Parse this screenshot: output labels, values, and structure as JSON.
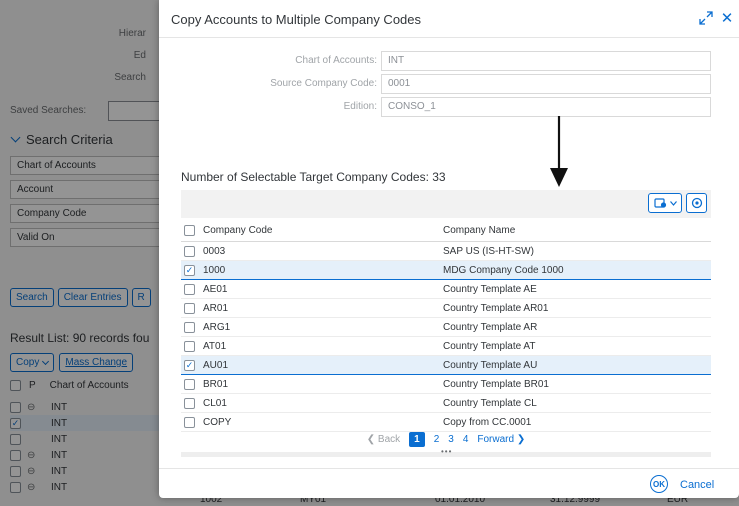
{
  "background": {
    "labels": {
      "hierarchy": "Hierar",
      "edition": "Ed",
      "search": "Search"
    },
    "saved_searches_label": "Saved Searches:",
    "search_criteria_title": "Search Criteria",
    "criteria_fields": [
      "Chart of Accounts",
      "Account",
      "Company Code",
      "Valid On"
    ],
    "buttons": {
      "search": "Search",
      "clear": "Clear Entries",
      "more": "R"
    },
    "result_title": "Result List: 90 records fou",
    "toolbar": {
      "copy": "Copy",
      "mass_change": "Mass Change"
    },
    "table_head": {
      "p": "P",
      "chart_of_accounts": "Chart of Accounts"
    },
    "rows": [
      {
        "value": "INT",
        "status": true,
        "selected": false,
        "checked": false
      },
      {
        "value": "INT",
        "status": false,
        "selected": true,
        "checked": true
      },
      {
        "value": "INT",
        "status": false,
        "selected": false,
        "checked": false
      },
      {
        "value": "INT",
        "status": true,
        "selected": false,
        "checked": false
      },
      {
        "value": "INT",
        "status": true,
        "selected": false,
        "checked": false
      },
      {
        "value": "INT",
        "status": true,
        "selected": false,
        "checked": false
      }
    ],
    "bottom_row_extra": [
      "1002",
      "MY01",
      "01.01.2010",
      "31.12.9999",
      "EUR"
    ]
  },
  "dialog": {
    "title": "Copy Accounts to Multiple Company Codes",
    "fields": [
      {
        "label": "Chart of Accounts:",
        "value": "INT"
      },
      {
        "label": "Source Company Code:",
        "value": "0001"
      },
      {
        "label": "Edition:",
        "value": "CONSO_1"
      }
    ],
    "selectable_title": "Number of Selectable Target Company Codes: 33",
    "columns": {
      "code": "Company Code",
      "name": "Company Name"
    },
    "rows": [
      {
        "code": "0003",
        "name": "SAP US (IS-HT-SW)",
        "checked": false
      },
      {
        "code": "1000",
        "name": "MDG Company Code 1000",
        "checked": true
      },
      {
        "code": "AE01",
        "name": "Country Template AE",
        "checked": false
      },
      {
        "code": "AR01",
        "name": "Country Template AR01",
        "checked": false
      },
      {
        "code": "ARG1",
        "name": "Country Template AR",
        "checked": false
      },
      {
        "code": "AT01",
        "name": "Country Template AT",
        "checked": false
      },
      {
        "code": "AU01",
        "name": "Country Template AU",
        "checked": true
      },
      {
        "code": "BR01",
        "name": "Country Template BR01",
        "checked": false
      },
      {
        "code": "CL01",
        "name": "Country Template CL",
        "checked": false
      },
      {
        "code": "COPY",
        "name": "Copy from CC.0001",
        "checked": false
      }
    ],
    "pager": {
      "back": "Back",
      "pages": [
        "1",
        "2",
        "3",
        "4"
      ],
      "current": "1",
      "forward": "Forward"
    },
    "footer": {
      "ok": "OK",
      "cancel": "Cancel"
    },
    "icons": {
      "resize": "resize-icon",
      "close": "close-icon",
      "arrow": "down-arrow-icon",
      "settings_menu": "table-settings-icon",
      "gear": "gear-icon"
    },
    "colors": {
      "accent": "#0a6ed1",
      "selected_row": "#e5f0fa"
    }
  }
}
